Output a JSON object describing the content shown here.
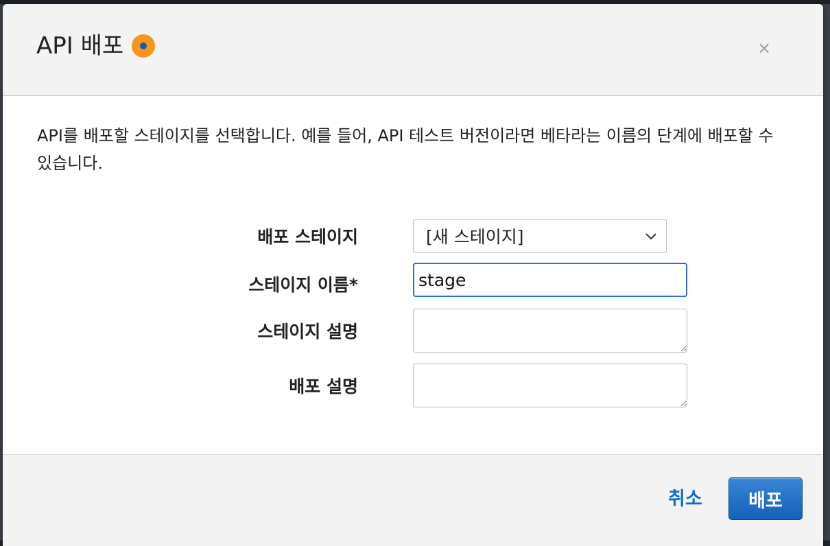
{
  "modal": {
    "title": "API 배포",
    "close_label": "×",
    "description": "API를 배포할 스테이지를 선택합니다. 예를 들어, API 테스트 버전이라면 베타라는 이름의 단계에 배포할 수 있습니다."
  },
  "form": {
    "deploy_stage_label": "배포 스테이지",
    "deploy_stage_value": "[새 스테이지]",
    "stage_name_label": "스테이지 이름*",
    "stage_name_value": "stage",
    "stage_description_label": "스테이지 설명",
    "deployment_description_label": "배포 설명"
  },
  "footer": {
    "cancel_label": "취소",
    "deploy_label": "배포"
  },
  "colors": {
    "accent": "#1561b8",
    "link": "#0f6fc6",
    "info_icon": "#f6961f",
    "focus_border": "#2e6ed3"
  }
}
